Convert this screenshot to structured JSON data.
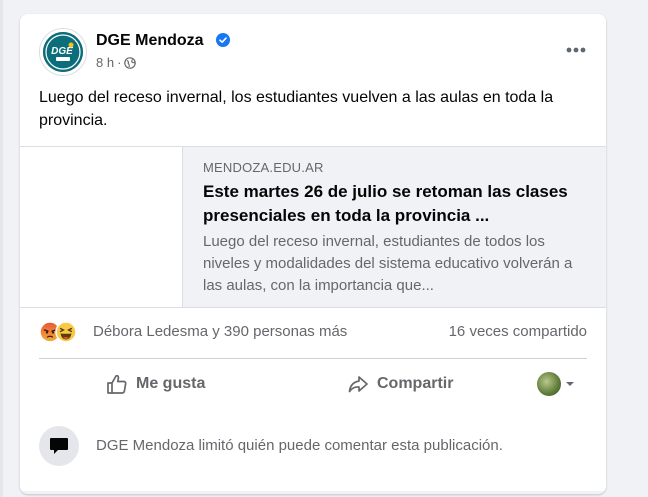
{
  "post": {
    "page_name": "DGE Mendoza",
    "avatar_text": "DGE",
    "time": "8 h",
    "text": "Luego del receso invernal, los estudiantes vuelven a las aulas en toda la provincia."
  },
  "link": {
    "domain": "MENDOZA.EDU.AR",
    "title": "Este martes 26 de julio se retoman las clases presenciales en toda la provincia ...",
    "description": "Luego del receso invernal, estudiantes de todos los niveles y modalidades del sistema educativo volverán a las aulas, con la importancia que..."
  },
  "reactions": {
    "icons": [
      "angry-reaction-icon",
      "haha-reaction-icon"
    ],
    "reactors_text": "Débora Ledesma y 390 personas más",
    "shares_text": "16 veces compartido"
  },
  "actions": {
    "like_label": "Me gusta",
    "share_label": "Compartir"
  },
  "comment_limit": {
    "text": "DGE Mendoza limitó quién puede comentar esta publicación."
  },
  "colors": {
    "verified_blue": "#1877f2",
    "secondary_text": "#65676b",
    "avatar_teal": "#0b6e7a"
  }
}
